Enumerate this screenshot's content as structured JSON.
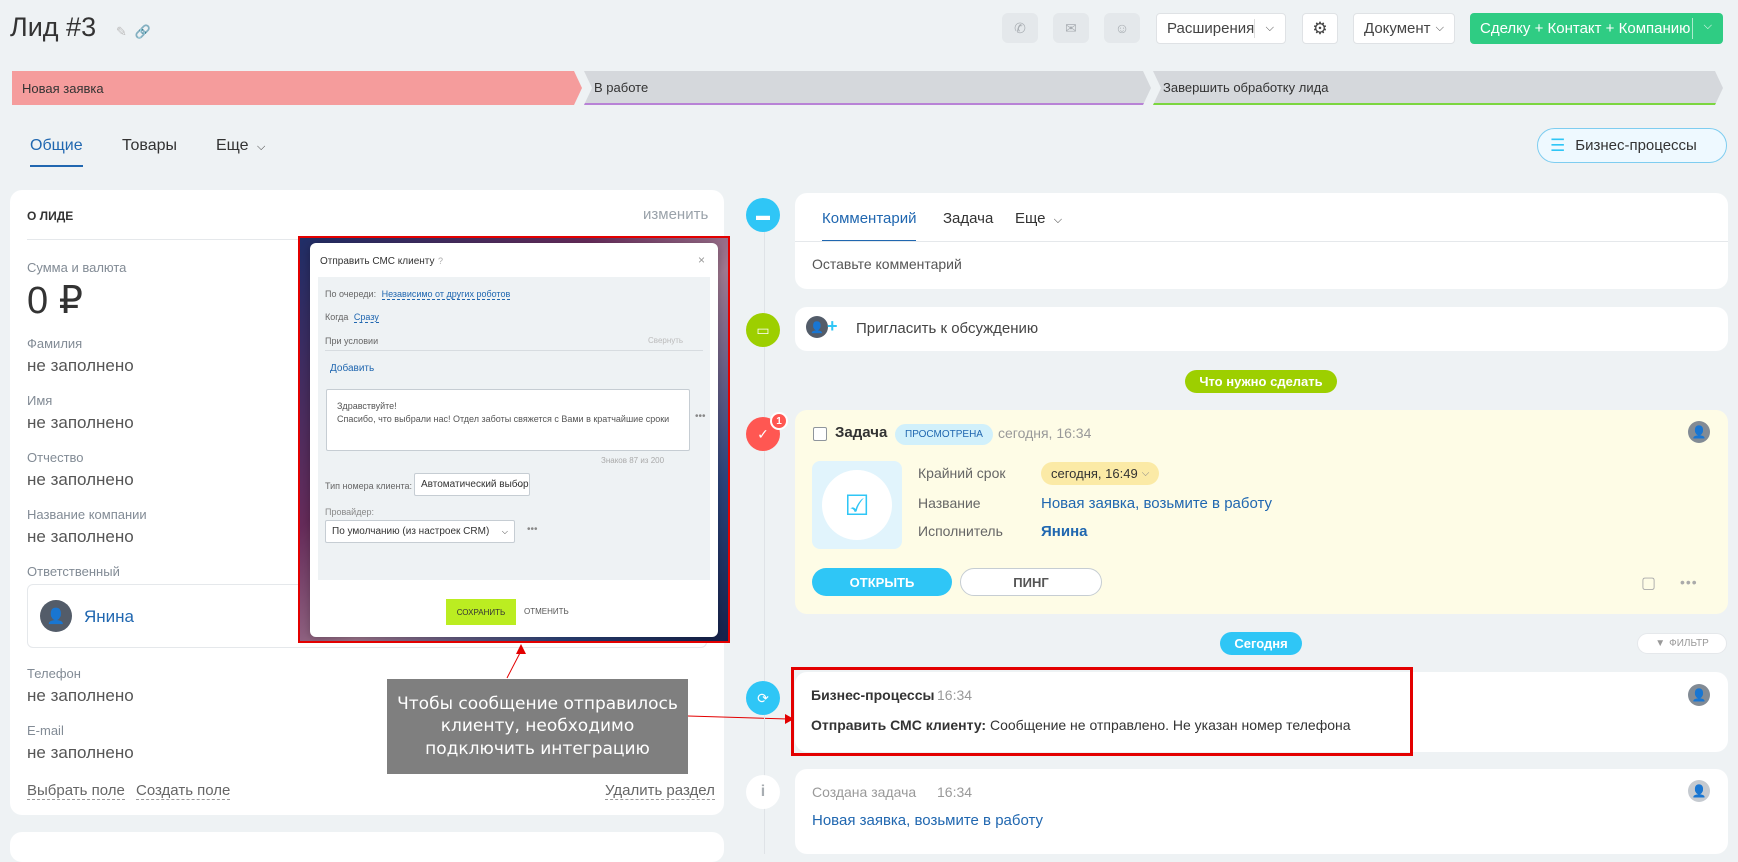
{
  "header": {
    "title": "Лид #3",
    "extensions_label": "Расширения",
    "document_label": "Документ",
    "create_label": "Сделку + Контакт + Компанию"
  },
  "stages": [
    {
      "label": "Новая заявка",
      "color": "#f59c9c"
    },
    {
      "label": "В работе",
      "color": "#d5d8dc"
    },
    {
      "label": "Завершить обработку лида",
      "color": "#d5d8dc"
    }
  ],
  "tabs": {
    "general": "Общие",
    "goods": "Товары",
    "more": "Еще"
  },
  "bp_button": "Бизнес-процессы",
  "lead": {
    "section_title": "О ЛИДЕ",
    "edit": "изменить",
    "fields": [
      {
        "label": "Сумма и валюта",
        "value": "0 ₽"
      },
      {
        "label": "Фамилия",
        "value": "не заполнено"
      },
      {
        "label": "Имя",
        "value": "не заполнено"
      },
      {
        "label": "Отчество",
        "value": "не заполнено"
      },
      {
        "label": "Название компании",
        "value": "не заполнено"
      },
      {
        "label": "Ответственный",
        "value": "Янина"
      },
      {
        "label": "Телефон",
        "value": "не заполнено"
      },
      {
        "label": "E-mail",
        "value": "не заполнено"
      }
    ],
    "footer": {
      "choose": "Выбрать поле",
      "create": "Создать поле",
      "delete": "Удалить раздел"
    }
  },
  "modal": {
    "title": "Отправить СМС клиенту",
    "queue_label": "По очереди:",
    "queue_value": "Независимо от других роботов",
    "when_label": "Когда",
    "when_value": "Сразу",
    "condition_label": "При условии",
    "collapse": "Свернуть",
    "add": "Добавить",
    "message_line1": "Здравствуйте!",
    "message_line2": "Спасибо, что выбрали нас! Отдел заботы свяжется с Вами в кратчайшие сроки",
    "chars": "Знаков 87 из 200",
    "number_type_label": "Тип номера клиента:",
    "number_type_value": "Автоматический выбор",
    "provider_label": "Провайдер:",
    "provider_value": "По умолчанию (из настроек CRM)",
    "save": "СОХРАНИТЬ",
    "cancel": "ОТМЕНИТЬ"
  },
  "callout": "Чтобы сообщение отправилось клиенту, необходимо подключить интеграцию",
  "timeline": {
    "tab_comment": "Комментарий",
    "tab_task": "Задача",
    "tab_more": "Еще",
    "comment_placeholder": "Оставьте комментарий",
    "invite": "Пригласить к обсуждению",
    "todo_badge": "Что нужно сделать",
    "task": {
      "title": "Задача",
      "status": "ПРОСМОТРЕНА",
      "time": "сегодня, 16:34",
      "badge_count": "1",
      "deadline_label": "Крайний срок",
      "deadline_value": "сегодня, 16:49",
      "name_label": "Название",
      "name_value": "Новая заявка, возьмите в работу",
      "assignee_label": "Исполнитель",
      "assignee_value": "Янина",
      "open": "ОТКРЫТЬ",
      "ping": "ПИНГ"
    },
    "today_badge": "Сегодня",
    "filter": "ФИЛЬТР",
    "bp_item": {
      "title": "Бизнес-процессы",
      "time": "16:34",
      "action": "Отправить СМС клиенту:",
      "message": "Сообщение не отправлено. Не указан номер телефона"
    },
    "created_item": {
      "title": "Создана задача",
      "time": "16:34",
      "link": "Новая заявка, возьмите в работу"
    }
  }
}
